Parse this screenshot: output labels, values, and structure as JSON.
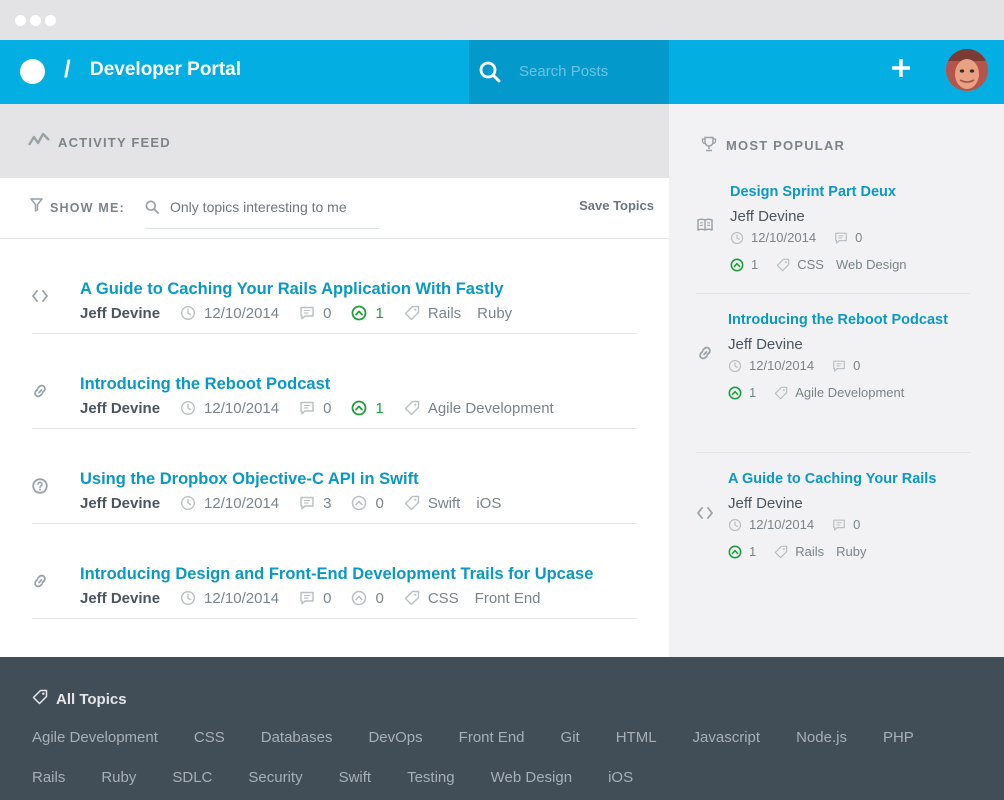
{
  "header": {
    "separator": "/",
    "title": "Developer Portal",
    "search_placeholder": "Search Posts"
  },
  "feed": {
    "label": "ACTIVITY FEED",
    "show_me": "SHOW ME:",
    "filter_placeholder": "Only topics interesting to me",
    "save_label": "Save Topics",
    "posts": [
      {
        "icon": "code-icon",
        "title": "A Guide to Caching Your Rails Application With Fastly",
        "author": "Jeff Devine",
        "date": "12/10/2014",
        "comments": "0",
        "upvotes": "1",
        "upvoted": true,
        "tags": [
          "Rails",
          "Ruby"
        ]
      },
      {
        "icon": "link-icon",
        "title": "Introducing the Reboot Podcast",
        "author": "Jeff Devine",
        "date": "12/10/2014",
        "comments": "0",
        "upvotes": "1",
        "upvoted": true,
        "tags": [
          "Agile Development"
        ]
      },
      {
        "icon": "question-icon",
        "title": "Using the Dropbox Objective-C API in Swift",
        "author": "Jeff Devine",
        "date": "12/10/2014",
        "comments": "3",
        "upvotes": "0",
        "upvoted": false,
        "tags": [
          "Swift",
          "iOS"
        ]
      },
      {
        "icon": "link-icon",
        "title": "Introducing Design and Front-End Development Trails for Upcase",
        "author": "Jeff Devine",
        "date": "12/10/2014",
        "comments": "0",
        "upvotes": "0",
        "upvoted": false,
        "tags": [
          "CSS",
          "Front End"
        ]
      }
    ]
  },
  "sidebar": {
    "title": "MOST POPULAR",
    "posts": [
      {
        "icon": "book-icon",
        "title": "Design Sprint Part Deux",
        "author": "Jeff Devine",
        "date": "12/10/2014",
        "comments": "0",
        "upvotes": "1",
        "tags": [
          "CSS",
          "Web Design"
        ]
      },
      {
        "icon": "link-icon",
        "title": "Introducing the Reboot Podcast",
        "author": "Jeff Devine",
        "date": "12/10/2014",
        "comments": "0",
        "upvotes": "1",
        "tags": [
          "Agile Development"
        ]
      },
      {
        "icon": "code-icon",
        "title": "A Guide to Caching Your Rails",
        "author": "Jeff Devine",
        "date": "12/10/2014",
        "comments": "0",
        "upvotes": "1",
        "tags": [
          "Rails",
          "Ruby"
        ]
      }
    ]
  },
  "footer": {
    "title": "All Topics",
    "topics_row1": [
      "Agile Development",
      "CSS",
      "Databases",
      "DevOps",
      "Front End",
      "Git",
      "HTML",
      "Javascript",
      "Node.js",
      "PHP"
    ],
    "topics_row2": [
      "Rails",
      "Ruby",
      "SDLC",
      "Security",
      "Swift",
      "Testing",
      "Web Design",
      "iOS"
    ]
  },
  "colors": {
    "brand": "#02aee2",
    "link": "#0a98c4",
    "upvote_active": "#1e9f3c",
    "footer_bg": "#414d57"
  }
}
